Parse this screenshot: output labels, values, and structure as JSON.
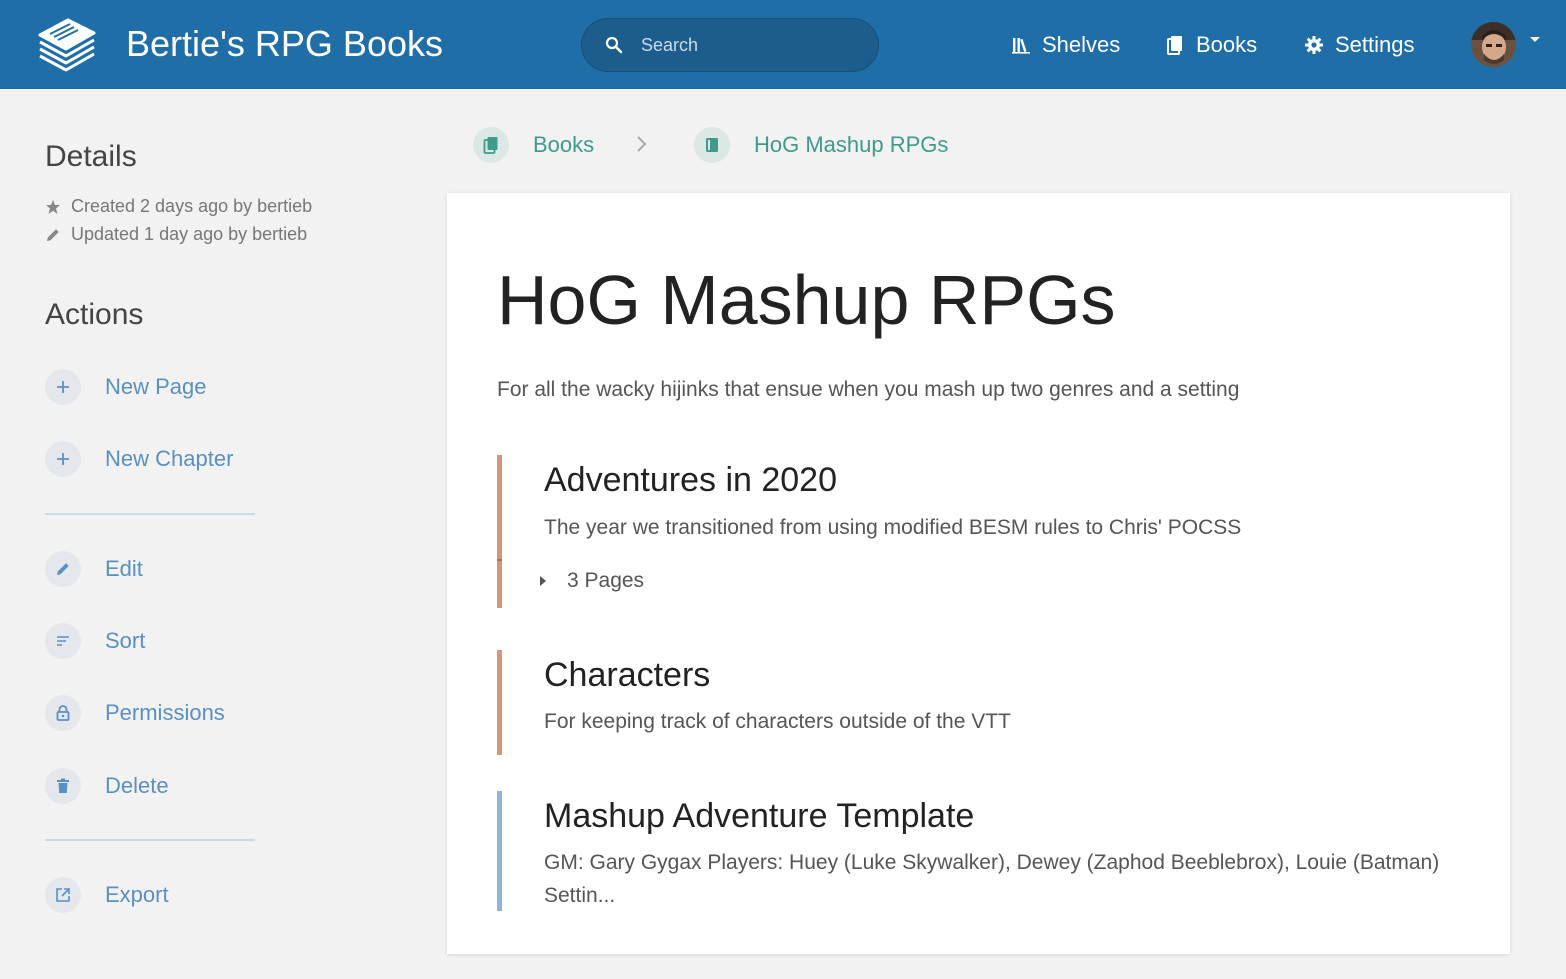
{
  "header": {
    "app_title": "Bertie's RPG Books",
    "search_placeholder": "Search",
    "nav": {
      "shelves": "Shelves",
      "books": "Books",
      "settings": "Settings"
    },
    "header_color": "#206ea7"
  },
  "sidebar": {
    "details_heading": "Details",
    "created": "Created 2 days ago by bertieb",
    "updated": "Updated 1 day ago by bertieb",
    "actions_heading": "Actions",
    "actions": {
      "new_page": "New Page",
      "new_chapter": "New Chapter",
      "edit": "Edit",
      "sort": "Sort",
      "permissions": "Permissions",
      "delete": "Delete",
      "export": "Export"
    }
  },
  "breadcrumb": {
    "books": "Books",
    "book": "HoG Mashup RPGs"
  },
  "book": {
    "title": "HoG Mashup RPGs",
    "description": "For all the wacky hijinks that ensue when you mash up two genres and a setting",
    "items": [
      {
        "type": "chapter",
        "title": "Adventures in 2020",
        "description": "The year we transitioned from using modified BESM rules to Chris' POCSS",
        "pages_label": "3 Pages"
      },
      {
        "type": "chapter",
        "title": "Characters",
        "description": "For keeping track of characters outside of the VTT"
      },
      {
        "type": "page",
        "title": "Mashup Adventure Template",
        "description": "GM: Gary Gygax Players: Huey (Luke Skywalker), Dewey (Zaphod Beeblebrox), Louie (Batman) Settin..."
      }
    ]
  },
  "colors": {
    "chapter_accent": "#d4977a",
    "page_accent": "#90b4d3",
    "action_link": "#5a90c0",
    "breadcrumb_link": "#3f9a8c"
  }
}
